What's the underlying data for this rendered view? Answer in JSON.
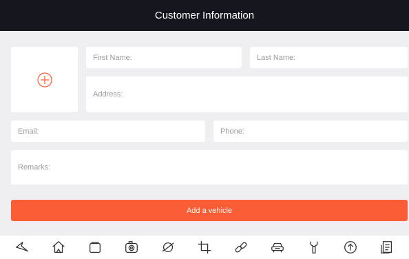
{
  "header": {
    "title": "Customer Information"
  },
  "form": {
    "first_name_label": "First Name:",
    "last_name_label": "Last Name:",
    "address_label": "Address:",
    "email_label": "Email:",
    "phone_label": "Phone:",
    "remarks_label": "Remarks:"
  },
  "actions": {
    "add_vehicle_label": "Add a vehicle"
  },
  "colors": {
    "accent": "#fb5d36",
    "header_bg": "#16161f",
    "background": "#efeff2"
  },
  "navbar": {
    "icons": [
      "back-icon",
      "home-icon",
      "recent-apps-icon",
      "camera-icon",
      "browser-icon",
      "crop-icon",
      "link-icon",
      "car-icon",
      "wrench-icon",
      "upload-icon",
      "report-icon"
    ]
  }
}
